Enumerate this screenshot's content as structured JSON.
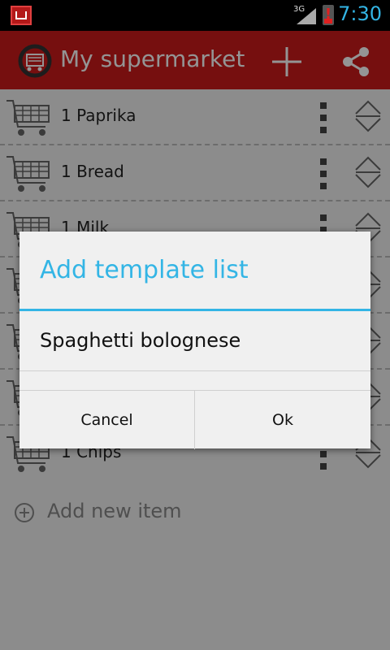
{
  "status_bar": {
    "network": "3G",
    "time": "7:30"
  },
  "action_bar": {
    "title": "My supermarket",
    "add_icon": "plus-icon",
    "share_icon": "share-icon",
    "logo_icon": "cart-logo-icon"
  },
  "list": {
    "items": [
      {
        "label": "1 Paprika"
      },
      {
        "label": "1 Bread"
      },
      {
        "label": "1 Milk"
      },
      {
        "label": ""
      },
      {
        "label": ""
      },
      {
        "label": ""
      },
      {
        "label": "1 Chips"
      }
    ],
    "add_new_label": "Add new item"
  },
  "dialog": {
    "title": "Add template list",
    "input_value": "Spaghetti bolognese",
    "cancel_label": "Cancel",
    "ok_label": "Ok"
  },
  "colors": {
    "accent": "#33b5e5",
    "action_bar": "#cc1b1b"
  }
}
